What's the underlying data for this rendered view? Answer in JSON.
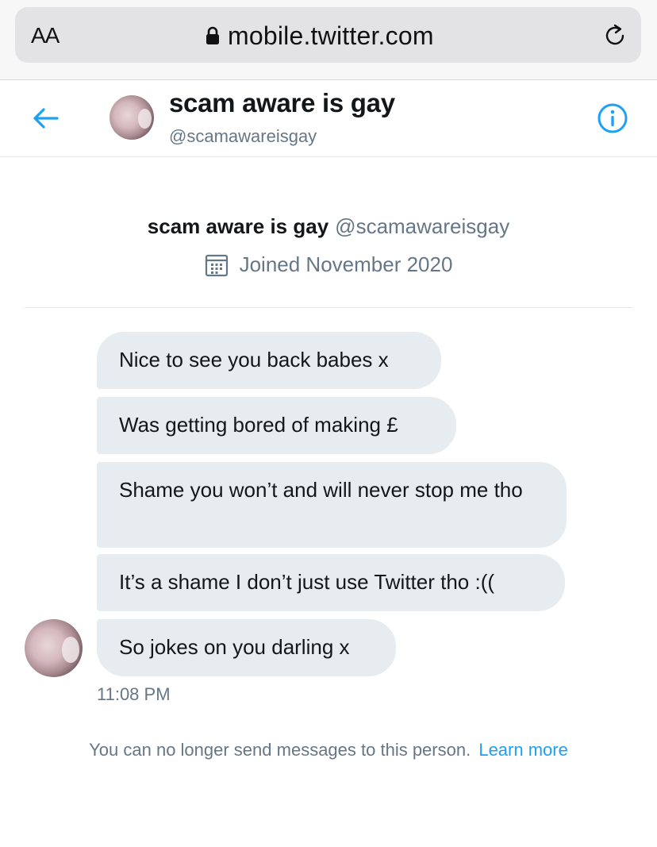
{
  "browser": {
    "text_size_label": "AA",
    "url": "mobile.twitter.com"
  },
  "header": {
    "display_name": "scam aware is gay",
    "handle": "@scamawareisgay"
  },
  "profile": {
    "display_name": "scam aware is gay",
    "handle": "@scamawareisgay",
    "joined": "Joined November 2020"
  },
  "messages": [
    {
      "text": "Nice to see you back babes x"
    },
    {
      "text": "Was getting bored of making £"
    },
    {
      "text": "Shame you won’t and will never stop me tho"
    },
    {
      "text": "It’s a shame I don’t just use Twitter tho :(("
    },
    {
      "text": "So jokes on you darling x"
    }
  ],
  "timestamp": "11:08 PM",
  "notice": {
    "text": "You can no longer send messages to this person.",
    "link": "Learn more"
  },
  "colors": {
    "accent": "#1da1f2",
    "bubble": "#e6ecf0",
    "secondary_text": "#657786"
  }
}
